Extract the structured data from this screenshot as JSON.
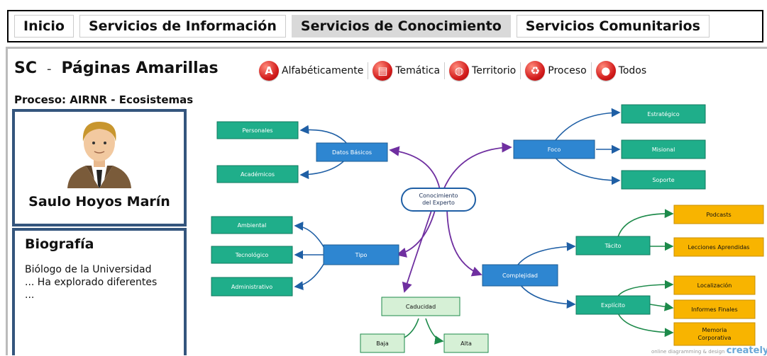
{
  "nav": {
    "tabs": [
      {
        "label": "Inicio"
      },
      {
        "label": "Servicios de Información"
      },
      {
        "label": "Servicios de Conocimiento"
      },
      {
        "label": "Servicios Comunitarios"
      }
    ],
    "active_index": 2
  },
  "header": {
    "prefix": "SC",
    "dash": "-",
    "title": "Páginas Amarillas"
  },
  "filters": [
    {
      "label": "Alfabéticamente",
      "icon": "letter-a-icon",
      "glyph": "A"
    },
    {
      "label": "Temática",
      "icon": "document-icon",
      "glyph": "▤"
    },
    {
      "label": "Territorio",
      "icon": "globe-icon",
      "glyph": "◍"
    },
    {
      "label": "Proceso",
      "icon": "recycle-icon",
      "glyph": "♻"
    },
    {
      "label": "Todos",
      "icon": "people-icon",
      "glyph": "●"
    }
  ],
  "process": "Proceso: AIRNR - Ecosistemas",
  "profile": {
    "name": "Saulo Hoyos Marín"
  },
  "bio": {
    "title": "Biografía",
    "lines": [
      "Biólogo de la Universidad",
      "... Ha explorado diferentes",
      "..."
    ]
  },
  "mindmap": {
    "center": [
      "Conocimiento",
      "del Experto"
    ],
    "datos_basicos": "Datos Básicos",
    "personales": "Personales",
    "academicos": "Académicos",
    "foco": "Foco",
    "estrategico": "Estratégico",
    "misional": "Misional",
    "soporte": "Soporte",
    "tipo": "Tipo",
    "ambiental": "Ambiental",
    "tecnologico": "Tecnológico",
    "administrativo": "Administrativo",
    "complejidad": "Complejidad",
    "tacito": "Tácito",
    "podcasts": "Podcasts",
    "lecciones": "Lecciones Aprendidas",
    "explicito": "Explícito",
    "localizacion": "Localización",
    "informes": "Informes Finales",
    "memoria": [
      "Memoria",
      "Corporativa"
    ],
    "caducidad": "Caducidad",
    "baja": "Baja",
    "alta": "Alta"
  },
  "footer": {
    "small": "online diagramming & design",
    "brand": "creately"
  },
  "colors": {
    "green_node": "#1fae8a",
    "blue_node": "#2e86d1",
    "orange_node": "#f8b400",
    "pale_green": "#d6f0d6",
    "panel_border": "#34557d",
    "filter_red": "#d41f1f"
  }
}
